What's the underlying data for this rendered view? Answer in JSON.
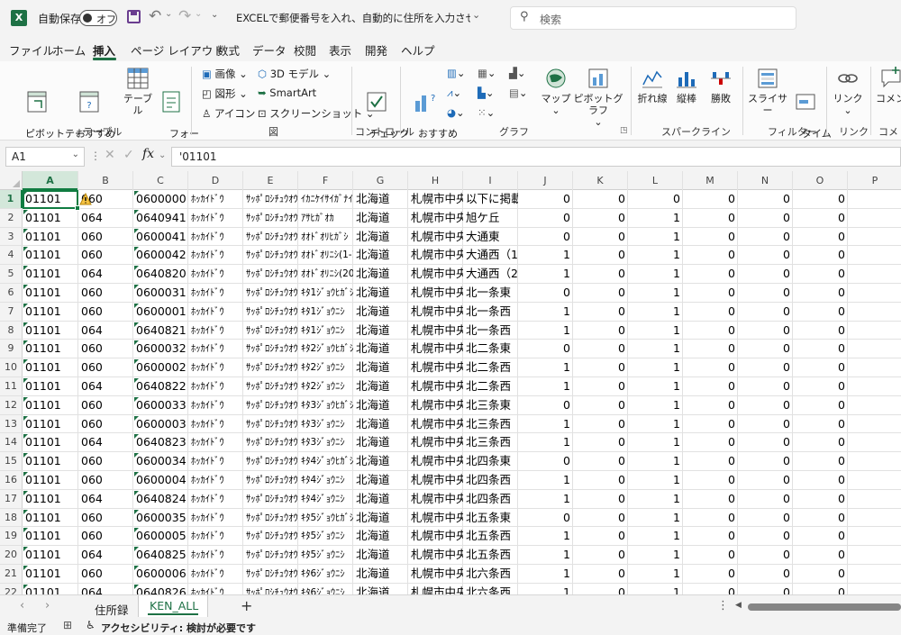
{
  "title": {
    "autosave_label": "自動保存",
    "autosave_state": "オフ",
    "document_name": "EXCELで郵便番号を入れ、自動的に住所を入力させる方…",
    "search_placeholder": "検索"
  },
  "menu": [
    "ファイル",
    "ホーム",
    "挿入",
    "ページ レイアウト",
    "数式",
    "データ",
    "校閲",
    "表示",
    "開発",
    "ヘルプ"
  ],
  "ribbon": {
    "pivot_table": "ピボットテー\nブル ∨",
    "recommended_pivot": "おすすめ\nピボットテーブル",
    "table": "テーブル",
    "forms": "フォー\nム ∨",
    "group_table": "テーブル",
    "pictures": "画像",
    "shapes": "図形",
    "icons": "アイコン",
    "model3d": "3D モデル",
    "smartart": "SmartArt",
    "screenshot": "スクリーンショット",
    "group_illustrations": "図",
    "checkbox": "チェック\nボックス",
    "group_controls": "コントロール",
    "recommended_charts": "おすすめ\nグラフ",
    "maps": "マップ",
    "pivot_chart": "ピボットグラフ",
    "group_charts": "グラフ",
    "line": "折れ線",
    "column": "縦棒",
    "winloss": "勝敗",
    "group_sparklines": "スパークライン",
    "slicer": "スライサー",
    "timeline": "タイム\nライン",
    "group_filters": "フィルター",
    "link": "リンク",
    "group_links": "リンク",
    "comment": "コメン",
    "group_comments": "コメン"
  },
  "formula": {
    "name_box": "A1",
    "content": "'01101"
  },
  "columns": [
    "A",
    "B",
    "C",
    "D",
    "E",
    "F",
    "G",
    "H",
    "I",
    "J",
    "K",
    "L",
    "M",
    "N",
    "O",
    "P"
  ],
  "rows": [
    [
      "1",
      "01101",
      "060",
      "0600000",
      "ﾎｯｶｲﾄﾞｳ",
      "ｻｯﾎﾟﾛｼﾁｭｳｵｳｸ",
      "ｲｶﾆｹｲｻｲｶﾞﾅｲﾊﾞｱｲ",
      "北海道",
      "札幌市中央区",
      "以下に掲載がない場合",
      "0",
      "0",
      "0",
      "0",
      "0",
      "0"
    ],
    [
      "2",
      "01101",
      "064",
      "0640941",
      "ﾎｯｶｲﾄﾞｳ",
      "ｻｯﾎﾟﾛｼﾁｭｳｵｳｸ",
      "ｱｻﾋｶﾞｵｶ",
      "北海道",
      "札幌市中央区",
      "旭ケ丘",
      "0",
      "0",
      "1",
      "0",
      "0",
      "0"
    ],
    [
      "3",
      "01101",
      "060",
      "0600041",
      "ﾎｯｶｲﾄﾞｳ",
      "ｻｯﾎﾟﾛｼﾁｭｳｵｳｸ",
      "ｵｵﾄﾞｵﾘﾋｶﾞｼ",
      "北海道",
      "札幌市中央区",
      "大通東",
      "0",
      "0",
      "1",
      "0",
      "0",
      "0"
    ],
    [
      "4",
      "01101",
      "060",
      "0600042",
      "ﾎｯｶｲﾄﾞｳ",
      "ｻｯﾎﾟﾛｼﾁｭｳｵｳｸ",
      "ｵｵﾄﾞｵﾘﾆｼ(1-19",
      "北海道",
      "札幌市中央区",
      "大通西（1",
      "1",
      "0",
      "1",
      "0",
      "0",
      "0"
    ],
    [
      "5",
      "01101",
      "064",
      "0640820",
      "ﾎｯｶｲﾄﾞｳ",
      "ｻｯﾎﾟﾛｼﾁｭｳｵｳｸ",
      "ｵｵﾄﾞｵﾘﾆｼ(20-",
      "北海道",
      "札幌市中央区",
      "大通西（2",
      "1",
      "0",
      "1",
      "0",
      "0",
      "0"
    ],
    [
      "6",
      "01101",
      "060",
      "0600031",
      "ﾎｯｶｲﾄﾞｳ",
      "ｻｯﾎﾟﾛｼﾁｭｳｵｳｸ",
      "ｷﾀ1ｼﾞｮｳﾋｶﾞｼ",
      "北海道",
      "札幌市中央区",
      "北一条東",
      "0",
      "0",
      "1",
      "0",
      "0",
      "0"
    ],
    [
      "7",
      "01101",
      "060",
      "0600001",
      "ﾎｯｶｲﾄﾞｳ",
      "ｻｯﾎﾟﾛｼﾁｭｳｵｳｸ",
      "ｷﾀ1ｼﾞｮｳﾆｼ",
      "北海道",
      "札幌市中央区",
      "北一条西",
      "1",
      "0",
      "1",
      "0",
      "0",
      "0"
    ],
    [
      "8",
      "01101",
      "064",
      "0640821",
      "ﾎｯｶｲﾄﾞｳ",
      "ｻｯﾎﾟﾛｼﾁｭｳｵｳｸ",
      "ｷﾀ1ｼﾞｮｳﾆｼ",
      "北海道",
      "札幌市中央区",
      "北一条西",
      "1",
      "0",
      "1",
      "0",
      "0",
      "0"
    ],
    [
      "9",
      "01101",
      "060",
      "0600032",
      "ﾎｯｶｲﾄﾞｳ",
      "ｻｯﾎﾟﾛｼﾁｭｳｵｳｸ",
      "ｷﾀ2ｼﾞｮｳﾋｶﾞｼ",
      "北海道",
      "札幌市中央区",
      "北二条東",
      "0",
      "0",
      "1",
      "0",
      "0",
      "0"
    ],
    [
      "10",
      "01101",
      "060",
      "0600002",
      "ﾎｯｶｲﾄﾞｳ",
      "ｻｯﾎﾟﾛｼﾁｭｳｵｳｸ",
      "ｷﾀ2ｼﾞｮｳﾆｼ",
      "北海道",
      "札幌市中央区",
      "北二条西",
      "1",
      "0",
      "1",
      "0",
      "0",
      "0"
    ],
    [
      "11",
      "01101",
      "064",
      "0640822",
      "ﾎｯｶｲﾄﾞｳ",
      "ｻｯﾎﾟﾛｼﾁｭｳｵｳｸ",
      "ｷﾀ2ｼﾞｮｳﾆｼ",
      "北海道",
      "札幌市中央区",
      "北二条西",
      "1",
      "0",
      "1",
      "0",
      "0",
      "0"
    ],
    [
      "12",
      "01101",
      "060",
      "0600033",
      "ﾎｯｶｲﾄﾞｳ",
      "ｻｯﾎﾟﾛｼﾁｭｳｵｳｸ",
      "ｷﾀ3ｼﾞｮｳﾋｶﾞｼ",
      "北海道",
      "札幌市中央区",
      "北三条東",
      "0",
      "0",
      "1",
      "0",
      "0",
      "0"
    ],
    [
      "13",
      "01101",
      "060",
      "0600003",
      "ﾎｯｶｲﾄﾞｳ",
      "ｻｯﾎﾟﾛｼﾁｭｳｵｳｸ",
      "ｷﾀ3ｼﾞｮｳﾆｼ",
      "北海道",
      "札幌市中央区",
      "北三条西",
      "1",
      "0",
      "1",
      "0",
      "0",
      "0"
    ],
    [
      "14",
      "01101",
      "064",
      "0640823",
      "ﾎｯｶｲﾄﾞｳ",
      "ｻｯﾎﾟﾛｼﾁｭｳｵｳｸ",
      "ｷﾀ3ｼﾞｮｳﾆｼ",
      "北海道",
      "札幌市中央区",
      "北三条西",
      "1",
      "0",
      "1",
      "0",
      "0",
      "0"
    ],
    [
      "15",
      "01101",
      "060",
      "0600034",
      "ﾎｯｶｲﾄﾞｳ",
      "ｻｯﾎﾟﾛｼﾁｭｳｵｳｸ",
      "ｷﾀ4ｼﾞｮｳﾋｶﾞｼ",
      "北海道",
      "札幌市中央区",
      "北四条東",
      "0",
      "0",
      "1",
      "0",
      "0",
      "0"
    ],
    [
      "16",
      "01101",
      "060",
      "0600004",
      "ﾎｯｶｲﾄﾞｳ",
      "ｻｯﾎﾟﾛｼﾁｭｳｵｳｸ",
      "ｷﾀ4ｼﾞｮｳﾆｼ",
      "北海道",
      "札幌市中央区",
      "北四条西",
      "1",
      "0",
      "1",
      "0",
      "0",
      "0"
    ],
    [
      "17",
      "01101",
      "064",
      "0640824",
      "ﾎｯｶｲﾄﾞｳ",
      "ｻｯﾎﾟﾛｼﾁｭｳｵｳｸ",
      "ｷﾀ4ｼﾞｮｳﾆｼ",
      "北海道",
      "札幌市中央区",
      "北四条西",
      "1",
      "0",
      "1",
      "0",
      "0",
      "0"
    ],
    [
      "18",
      "01101",
      "060",
      "0600035",
      "ﾎｯｶｲﾄﾞｳ",
      "ｻｯﾎﾟﾛｼﾁｭｳｵｳｸ",
      "ｷﾀ5ｼﾞｮｳﾋｶﾞｼ",
      "北海道",
      "札幌市中央区",
      "北五条東",
      "0",
      "0",
      "1",
      "0",
      "0",
      "0"
    ],
    [
      "19",
      "01101",
      "060",
      "0600005",
      "ﾎｯｶｲﾄﾞｳ",
      "ｻｯﾎﾟﾛｼﾁｭｳｵｳｸ",
      "ｷﾀ5ｼﾞｮｳﾆｼ",
      "北海道",
      "札幌市中央区",
      "北五条西",
      "1",
      "0",
      "1",
      "0",
      "0",
      "0"
    ],
    [
      "20",
      "01101",
      "064",
      "0640825",
      "ﾎｯｶｲﾄﾞｳ",
      "ｻｯﾎﾟﾛｼﾁｭｳｵｳｸ",
      "ｷﾀ5ｼﾞｮｳﾆｼ",
      "北海道",
      "札幌市中央区",
      "北五条西",
      "1",
      "0",
      "1",
      "0",
      "0",
      "0"
    ],
    [
      "21",
      "01101",
      "060",
      "0600006",
      "ﾎｯｶｲﾄﾞｳ",
      "ｻｯﾎﾟﾛｼﾁｭｳｵｳｸ",
      "ｷﾀ6ｼﾞｮｳﾆｼ",
      "北海道",
      "札幌市中央区",
      "北六条西",
      "1",
      "0",
      "1",
      "0",
      "0",
      "0"
    ],
    [
      "22",
      "01101",
      "064",
      "0640826",
      "ﾎｯｶｲﾄﾞｳ",
      "ｻｯﾎﾟﾛｼﾁｭｳｵｳｸ",
      "ｷﾀ6ｼﾞｮｳﾆｼ",
      "北海道",
      "札幌市中央区",
      "北六条西",
      "1",
      "0",
      "1",
      "0",
      "0",
      "0"
    ]
  ],
  "sheets": [
    "住所録",
    "KEN_ALL"
  ],
  "active_sheet": "KEN_ALL",
  "status": {
    "ready": "準備完了",
    "accessibility": "アクセシビリティ: 検討が必要です"
  },
  "colors": {
    "excel_green": "#1e7145",
    "selection": "#107c41",
    "header_bg": "#f3f3f3",
    "gridline": "#e1e1e1"
  }
}
